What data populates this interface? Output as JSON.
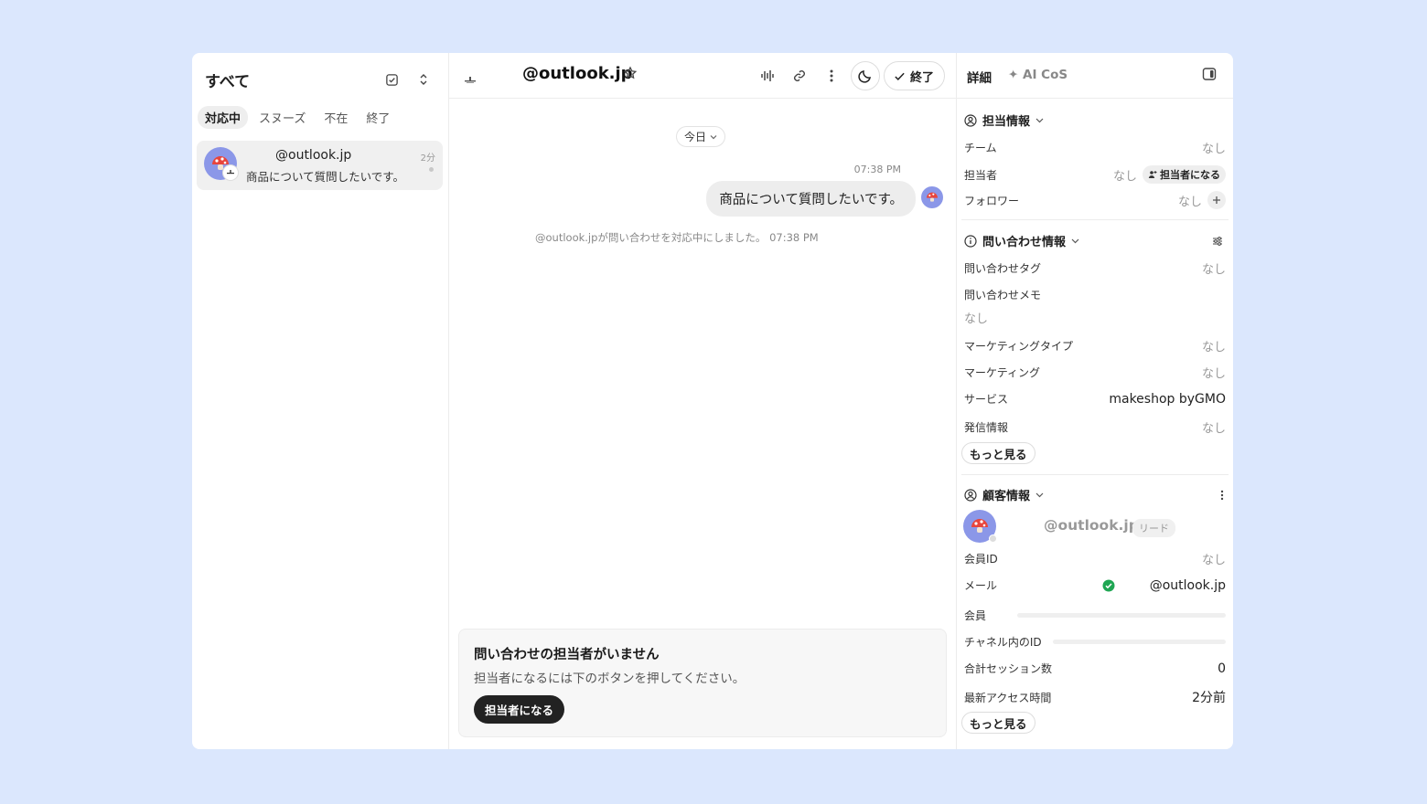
{
  "left": {
    "title": "すべて",
    "tabs": [
      {
        "label": "対応中",
        "active": true
      },
      {
        "label": "スヌーズ",
        "active": false
      },
      {
        "label": "不在",
        "active": false
      },
      {
        "label": "終了",
        "active": false
      }
    ],
    "conversation": {
      "name": "@outlook.jp",
      "time": "2分",
      "preview": "商品について質問したいです。"
    }
  },
  "chat": {
    "title": "@outlook.jp",
    "close_label": "終了",
    "date_pill": "今日",
    "message_time": "07:38 PM",
    "message_text": "商品について質問したいです。",
    "system_text": "@outlook.jpが問い合わせを対応中にしました。 07:38 PM",
    "notice_title": "問い合わせの担当者がいません",
    "notice_desc": "担当者になるには下のボタンを押してください。",
    "notice_button": "担当者になる"
  },
  "detail": {
    "tab_details": "詳細",
    "tab_ai": "✦ AI CoS",
    "assign_section": {
      "title": "担当情報",
      "rows": [
        {
          "label": "チーム",
          "value": "なし"
        },
        {
          "label": "担当者",
          "value": "なし",
          "chip": "担当者になる"
        },
        {
          "label": "フォロワー",
          "value": "なし"
        }
      ]
    },
    "inquiry_section": {
      "title": "問い合わせ情報",
      "rows": [
        {
          "label": "問い合わせタグ",
          "value": "なし"
        },
        {
          "label": "問い合わせメモ",
          "value": "なし"
        },
        {
          "label": "マーケティングタイプ",
          "value": "なし"
        },
        {
          "label": "マーケティング",
          "value": "なし"
        },
        {
          "label": "サービス",
          "value": "makeshop byGMO"
        },
        {
          "label": "発信情報",
          "value": "なし"
        }
      ],
      "more": "もっと見る"
    },
    "customer_section": {
      "title": "顧客情報",
      "name": "@outlook.jp",
      "badge": "リード",
      "rows": [
        {
          "label": "会員ID",
          "value": "なし"
        },
        {
          "label": "メール",
          "value": "@outlook.jp"
        },
        {
          "label": "会員",
          "value": ""
        },
        {
          "label": "チャネル内のID",
          "value": ""
        },
        {
          "label": "合計セッション数",
          "value": "0"
        },
        {
          "label": "最新アクセス時間",
          "value": "2分前"
        }
      ],
      "more": "もっと見る"
    }
  },
  "colors": {
    "background": "#dbe7fd",
    "avatar": "#8b97e8",
    "mushroom": "#e8453c",
    "verified": "#1fa653",
    "button_dark": "#222222"
  }
}
